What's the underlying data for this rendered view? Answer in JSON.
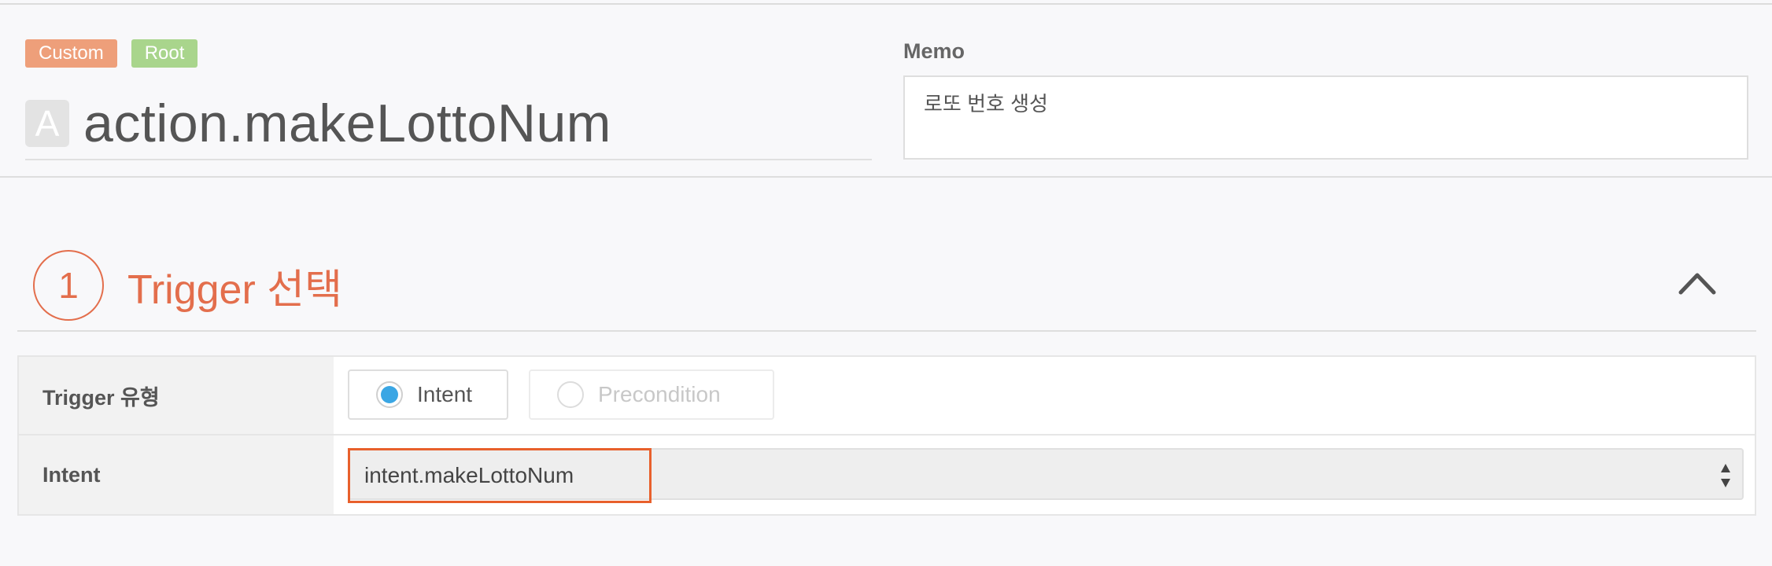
{
  "badges": {
    "custom": "Custom",
    "root": "Root"
  },
  "header": {
    "type_icon_letter": "A",
    "title": "action.makeLottoNum"
  },
  "memo": {
    "label": "Memo",
    "value": "로또 번호 생성"
  },
  "section": {
    "step": "1",
    "title": "Trigger 선택",
    "collapse_icon": "chevron-up-icon"
  },
  "trigger_type": {
    "label": "Trigger 유형",
    "options": [
      {
        "label": "Intent",
        "checked": true
      },
      {
        "label": "Precondition",
        "checked": false,
        "disabled": true
      }
    ]
  },
  "intent": {
    "label": "Intent",
    "selected": "intent.makeLottoNum"
  },
  "colors": {
    "accent": "#e36e4c",
    "radio_checked": "#3aa6e4",
    "custom_badge": "#ee9f7a",
    "root_badge": "#a9d58c",
    "highlight": "#e8602c"
  }
}
